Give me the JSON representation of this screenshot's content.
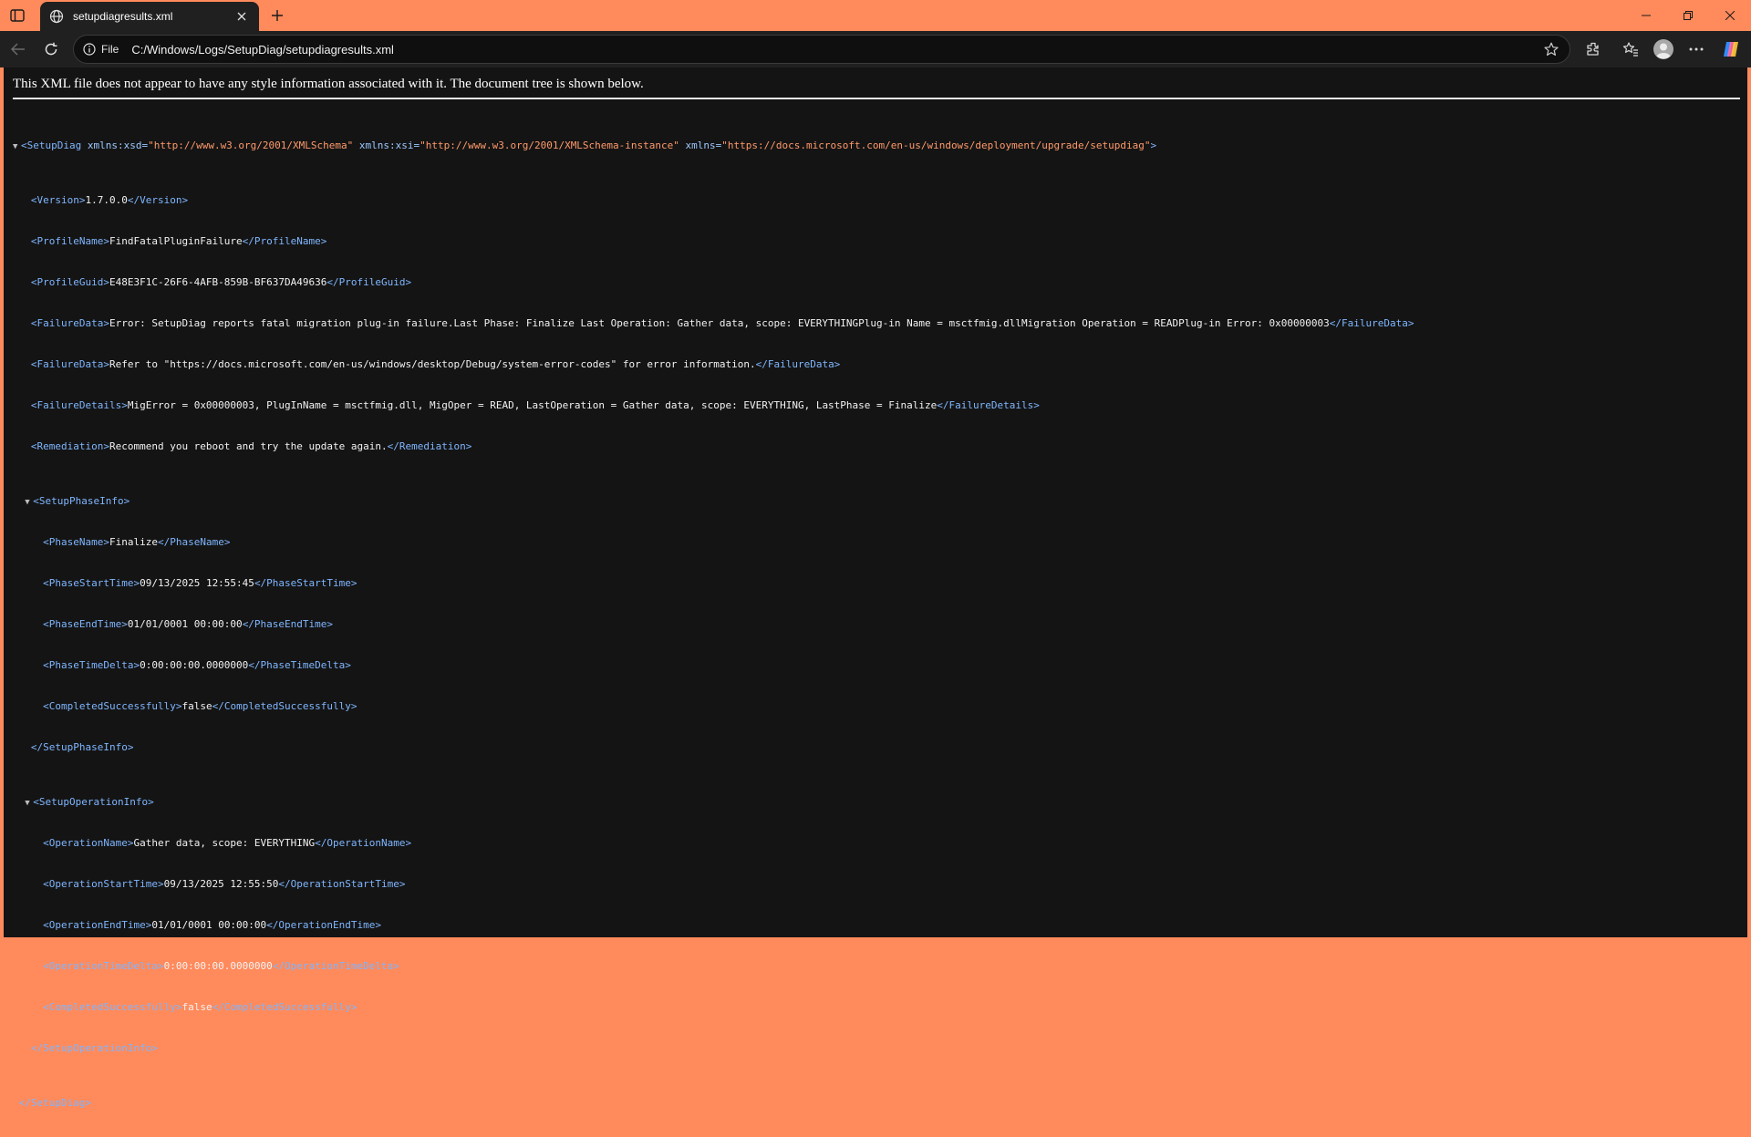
{
  "browser": {
    "tab_title": "setupdiagresults.xml",
    "scheme_label": "File",
    "url": "C:/Windows/Logs/SetupDiag/setupdiagresults.xml",
    "theme_color": "#ff8a5b"
  },
  "page": {
    "notice": "This XML file does not appear to have any style information associated with it. The document tree is shown below.",
    "root_open": "<SetupDiag",
    "root_attrs": [
      {
        "name": "xmlns:xsd",
        "value": "\"http://www.w3.org/2001/XMLSchema\""
      },
      {
        "name": "xmlns:xsi",
        "value": "\"http://www.w3.org/2001/XMLSchema-instance\""
      },
      {
        "name": "xmlns",
        "value": "\"https://docs.microsoft.com/en-us/windows/deployment/upgrade/setupdiag\""
      }
    ],
    "root_open_end": ">",
    "root_close": "</SetupDiag>",
    "elements": [
      {
        "open": "<Version>",
        "text": "1.7.0.0",
        "close": "</Version>"
      },
      {
        "open": "<ProfileName>",
        "text": "FindFatalPluginFailure",
        "close": "</ProfileName>"
      },
      {
        "open": "<ProfileGuid>",
        "text": "E48E3F1C-26F6-4AFB-859B-BF637DA49636",
        "close": "</ProfileGuid>"
      },
      {
        "open": "<FailureData>",
        "text": "Error: SetupDiag reports fatal migration plug-in failure.Last Phase: Finalize Last Operation: Gather data, scope: EVERYTHINGPlug-in Name = msctfmig.dllMigration Operation = READPlug-in Error: 0x00000003",
        "close": "</FailureData>"
      },
      {
        "open": "<FailureData>",
        "text": "Refer to \"https://docs.microsoft.com/en-us/windows/desktop/Debug/system-error-codes\" for error information.",
        "close": "</FailureData>"
      },
      {
        "open": "<FailureDetails>",
        "text": "MigError = 0x00000003, PlugInName = msctfmig.dll, MigOper = READ, LastOperation = Gather data, scope: EVERYTHING, LastPhase = Finalize",
        "close": "</FailureDetails>"
      },
      {
        "open": "<Remediation>",
        "text": "Recommend you reboot and try the update again.",
        "close": "</Remediation>"
      }
    ],
    "phase_info": {
      "open": "<SetupPhaseInfo>",
      "close": "</SetupPhaseInfo>",
      "children": [
        {
          "open": "<PhaseName>",
          "text": "Finalize",
          "close": "</PhaseName>"
        },
        {
          "open": "<PhaseStartTime>",
          "text": "09/13/2025 12:55:45",
          "close": "</PhaseStartTime>"
        },
        {
          "open": "<PhaseEndTime>",
          "text": "01/01/0001 00:00:00",
          "close": "</PhaseEndTime>"
        },
        {
          "open": "<PhaseTimeDelta>",
          "text": "0:00:00:00.0000000",
          "close": "</PhaseTimeDelta>"
        },
        {
          "open": "<CompletedSuccessfully>",
          "text": "false",
          "close": "</CompletedSuccessfully>"
        }
      ]
    },
    "operation_info": {
      "open": "<SetupOperationInfo>",
      "close": "</SetupOperationInfo>",
      "children": [
        {
          "open": "<OperationName>",
          "text": "Gather data, scope: EVERYTHING",
          "close": "</OperationName>"
        },
        {
          "open": "<OperationStartTime>",
          "text": "09/13/2025 12:55:50",
          "close": "</OperationStartTime>"
        },
        {
          "open": "<OperationEndTime>",
          "text": "01/01/0001 00:00:00",
          "close": "</OperationEndTime>"
        },
        {
          "open": "<OperationTimeDelta>",
          "text": "0:00:00:00.0000000",
          "close": "</OperationTimeDelta>"
        },
        {
          "open": "<CompletedSuccessfully>",
          "text": "false",
          "close": "</CompletedSuccessfully>"
        }
      ]
    }
  }
}
